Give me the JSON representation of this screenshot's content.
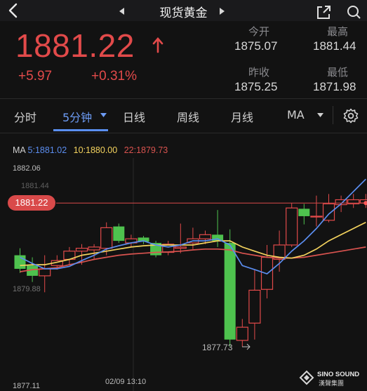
{
  "header": {
    "title": "现货黄金",
    "back_icon": "chevron-left-icon",
    "prev_icon": "triangle-left-icon",
    "next_icon": "triangle-right-icon",
    "share_icon": "share-icon",
    "search_icon": "search-icon"
  },
  "quote": {
    "price": "1881.22",
    "change": "+5.97",
    "change_pct": "+0.31%",
    "color_up": "#e24a4a",
    "stats": {
      "open_label": "今开",
      "open_value": "1875.07",
      "high_label": "最高",
      "high_value": "1881.44",
      "prev_close_label": "昨收",
      "prev_close_value": "1875.25",
      "low_label": "最低",
      "low_value": "1871.98"
    }
  },
  "tabs": {
    "items": [
      "分时",
      "5分钟",
      "日线",
      "周线",
      "月线",
      "MA"
    ],
    "active": "5分钟",
    "settings_icon": "gear-icon"
  },
  "ma_legend": {
    "ma_label": "MA",
    "ma5": "5:1881.02",
    "ma10": "10:1880.00",
    "ma22": "22:1879.73",
    "ma5_color": "#5b8def",
    "ma10_color": "#f4d35e",
    "ma22_color": "#d9534f"
  },
  "chart_data": {
    "type": "candlestick",
    "axis_labels": {
      "top": "1882.06",
      "top_partial": "1881.44",
      "mid": "1879.88",
      "bottom": "1877.11",
      "low_marker": "1877.73",
      "time": "02/09 13:10"
    },
    "current_price_tag": "1881.22",
    "current_price": 1881.22,
    "ylim": [
      1877.11,
      1882.06
    ],
    "up_color": "#e24a4a",
    "down_color": "#4ec24e",
    "candles": [
      {
        "o": 1879.95,
        "h": 1880.12,
        "l": 1879.52,
        "c": 1879.62,
        "dir": "down"
      },
      {
        "o": 1879.7,
        "h": 1879.9,
        "l": 1879.3,
        "c": 1879.45,
        "dir": "down"
      },
      {
        "o": 1879.45,
        "h": 1879.95,
        "l": 1879.05,
        "c": 1879.62,
        "dir": "up"
      },
      {
        "o": 1879.7,
        "h": 1879.95,
        "l": 1879.6,
        "c": 1879.82,
        "dir": "up"
      },
      {
        "o": 1879.85,
        "h": 1880.15,
        "l": 1879.72,
        "c": 1880.05,
        "dir": "up"
      },
      {
        "o": 1880.05,
        "h": 1880.22,
        "l": 1879.72,
        "c": 1880.12,
        "dir": "up"
      },
      {
        "o": 1880.08,
        "h": 1880.22,
        "l": 1879.85,
        "c": 1880.15,
        "dir": "up"
      },
      {
        "o": 1880.12,
        "h": 1880.75,
        "l": 1879.95,
        "c": 1880.62,
        "dir": "up"
      },
      {
        "o": 1880.65,
        "h": 1880.72,
        "l": 1880.25,
        "c": 1880.3,
        "dir": "down"
      },
      {
        "o": 1880.25,
        "h": 1880.45,
        "l": 1880.15,
        "c": 1880.35,
        "dir": "up"
      },
      {
        "o": 1880.38,
        "h": 1880.42,
        "l": 1880.22,
        "c": 1880.28,
        "dir": "down"
      },
      {
        "o": 1880.25,
        "h": 1880.3,
        "l": 1879.9,
        "c": 1879.95,
        "dir": "down"
      },
      {
        "o": 1880.02,
        "h": 1880.3,
        "l": 1879.95,
        "c": 1880.22,
        "dir": "up"
      },
      {
        "o": 1880.12,
        "h": 1880.72,
        "l": 1880.0,
        "c": 1880.15,
        "dir": "up"
      },
      {
        "o": 1880.25,
        "h": 1880.62,
        "l": 1880.1,
        "c": 1880.35,
        "dir": "up"
      },
      {
        "o": 1880.35,
        "h": 1880.55,
        "l": 1880.22,
        "c": 1880.45,
        "dir": "up"
      },
      {
        "o": 1880.45,
        "h": 1881.05,
        "l": 1880.15,
        "c": 1880.3,
        "dir": "down"
      },
      {
        "o": 1880.25,
        "h": 1880.58,
        "l": 1877.73,
        "c": 1877.9,
        "dir": "down"
      },
      {
        "o": 1877.88,
        "h": 1878.4,
        "l": 1877.73,
        "c": 1878.2,
        "dir": "up"
      },
      {
        "o": 1878.3,
        "h": 1879.6,
        "l": 1877.9,
        "c": 1879.1,
        "dir": "up"
      },
      {
        "o": 1879.12,
        "h": 1880.2,
        "l": 1878.9,
        "c": 1879.9,
        "dir": "up"
      },
      {
        "o": 1879.85,
        "h": 1880.55,
        "l": 1879.55,
        "c": 1880.2,
        "dir": "up"
      },
      {
        "o": 1880.2,
        "h": 1881.22,
        "l": 1880.15,
        "c": 1881.1,
        "dir": "up"
      },
      {
        "o": 1881.08,
        "h": 1881.2,
        "l": 1880.7,
        "c": 1880.9,
        "dir": "down"
      },
      {
        "o": 1880.9,
        "h": 1881.4,
        "l": 1880.65,
        "c": 1880.9,
        "dir": "flat"
      },
      {
        "o": 1880.8,
        "h": 1881.44,
        "l": 1880.75,
        "c": 1881.2,
        "dir": "up"
      },
      {
        "o": 1881.18,
        "h": 1881.4,
        "l": 1881.0,
        "c": 1881.3,
        "dir": "up"
      },
      {
        "o": 1881.2,
        "h": 1881.44,
        "l": 1881.1,
        "c": 1881.3,
        "dir": "up"
      },
      {
        "o": 1881.22,
        "h": 1881.44,
        "l": 1881.1,
        "c": 1881.3,
        "dir": "up"
      }
    ],
    "ma5": [
      1879.9,
      1879.75,
      1879.62,
      1879.62,
      1879.68,
      1879.82,
      1879.95,
      1880.1,
      1880.18,
      1880.25,
      1880.3,
      1880.2,
      1880.15,
      1880.2,
      1880.3,
      1880.3,
      1880.35,
      1880.2,
      1879.7,
      1879.6,
      1879.5,
      1879.75,
      1880.05,
      1880.3,
      1880.6,
      1880.95,
      1881.2,
      1881.5,
      1881.8
    ],
    "ma10": [
      1879.7,
      1879.72,
      1879.72,
      1879.78,
      1879.85,
      1879.95,
      1880.0,
      1880.05,
      1880.1,
      1880.15,
      1880.18,
      1880.2,
      1880.2,
      1880.2,
      1880.2,
      1880.25,
      1880.3,
      1880.3,
      1880.15,
      1880.05,
      1879.95,
      1879.9,
      1879.88,
      1879.95,
      1880.1,
      1880.3,
      1880.45,
      1880.6,
      1880.75
    ],
    "ma22": [
      1879.55,
      1879.6,
      1879.62,
      1879.65,
      1879.72,
      1879.78,
      1879.85,
      1879.9,
      1879.95,
      1879.98,
      1880.0,
      1880.02,
      1880.03,
      1880.05,
      1880.08,
      1880.1,
      1880.1,
      1880.08,
      1880.0,
      1879.95,
      1879.9,
      1879.88,
      1879.88,
      1879.9,
      1879.95,
      1880.0,
      1880.05,
      1880.1,
      1880.15
    ]
  },
  "watermark": {
    "brand": "SINO SOUND",
    "sub": "漢聲集團",
    "icon": "sinosound-logo-icon"
  }
}
